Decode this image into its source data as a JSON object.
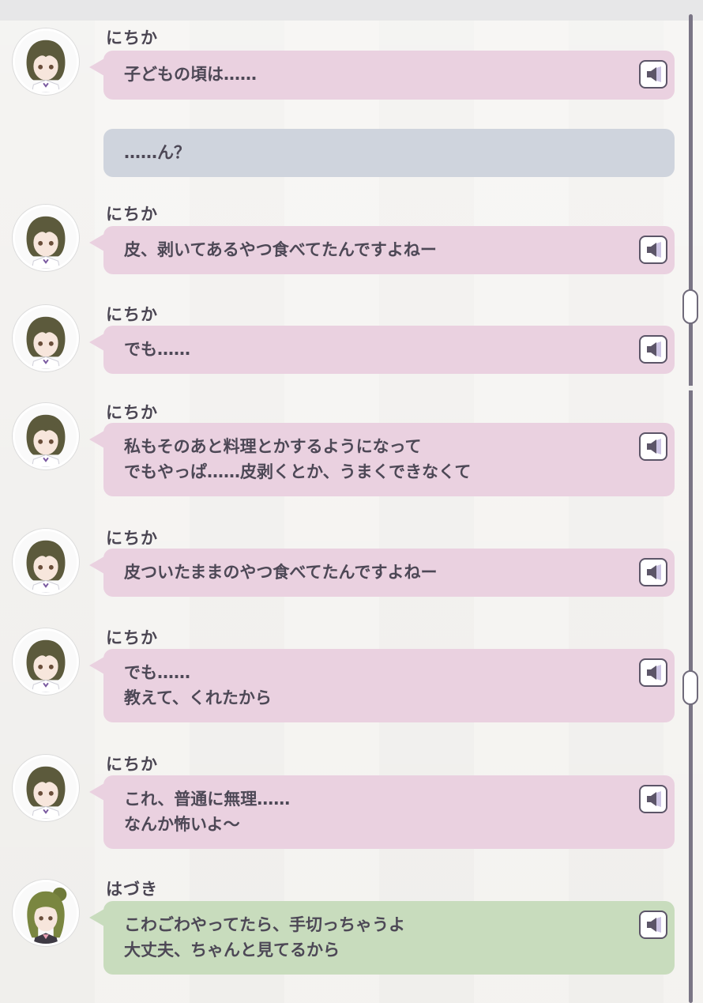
{
  "log": {
    "entries": [
      {
        "speaker": "にちか",
        "lines": [
          "子どもの頃は……"
        ],
        "style": "pink",
        "avatar": "nichika-avatar-icon",
        "has_voice": true
      },
      {
        "speaker": "",
        "lines": [
          "……ん？"
        ],
        "style": "gray",
        "avatar": "",
        "has_voice": false
      },
      {
        "speaker": "にちか",
        "lines": [
          "皮、剥いてあるやつ食べてたんですよねー"
        ],
        "style": "pink",
        "avatar": "nichika-avatar-icon",
        "has_voice": true
      },
      {
        "speaker": "にちか",
        "lines": [
          "でも……"
        ],
        "style": "pink",
        "avatar": "nichika-avatar-icon",
        "has_voice": true
      },
      {
        "speaker": "にちか",
        "lines": [
          "私もそのあと料理とかするようになって",
          "でもやっぱ……皮剥くとか、うまくできなくて"
        ],
        "style": "pink",
        "avatar": "nichika-avatar-icon",
        "has_voice": true
      },
      {
        "speaker": "にちか",
        "lines": [
          "皮ついたままのやつ食べてたんですよねー"
        ],
        "style": "pink",
        "avatar": "nichika-avatar-icon",
        "has_voice": true
      },
      {
        "speaker": "にちか",
        "lines": [
          "でも……",
          "教えて、くれたから"
        ],
        "style": "pink",
        "avatar": "nichika-avatar-icon",
        "has_voice": true
      },
      {
        "speaker": "にちか",
        "lines": [
          "これ、普通に無理……",
          "なんか怖いよ～"
        ],
        "style": "pink",
        "avatar": "nichika-avatar-icon",
        "has_voice": true
      },
      {
        "speaker": "はづき",
        "lines": [
          "こわごわやってたら、手切っちゃうよ",
          "大丈夫、ちゃんと見てるから"
        ],
        "style": "green",
        "avatar": "hazuki-avatar-icon",
        "has_voice": true
      }
    ]
  },
  "colors": {
    "nichika_bubble": "#ead1e0",
    "hazuki_bubble": "#c8dcbd",
    "player_bubble": "#cfd4dd",
    "text": "#4d4856"
  },
  "icons": {
    "voice": "speaker-icon"
  }
}
